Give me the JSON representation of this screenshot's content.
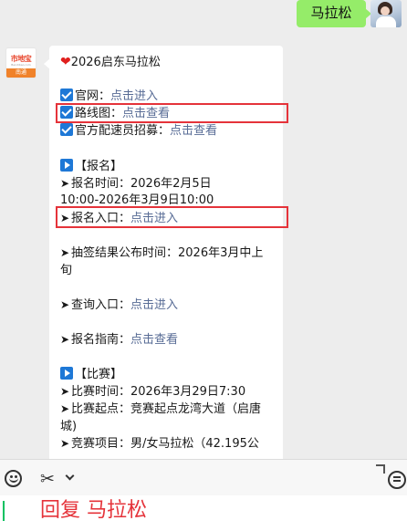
{
  "outgoing": {
    "text": "马拉松"
  },
  "bot": {
    "logo_main": "市地宝",
    "logo_sub": "Bendibao.com",
    "logo_city": "南通"
  },
  "message": {
    "title": "2026启东马拉松",
    "official_site_label": "官网：",
    "official_site_link": "点击进入",
    "route_label": "路线图：",
    "route_link": "点击查看",
    "pacer_label": "官方配速员招募：",
    "pacer_link": "点击查看",
    "reg_section": "【报名】",
    "reg_time_l1": "报名时间：2026年2月5日",
    "reg_time_l2": "10:00-2026年3月9日10:00",
    "reg_entry_label": "报名入口：",
    "reg_entry_link": "点击进入",
    "lottery": "抽签结果公布时间：2026年3月中上旬",
    "query_label": "查询入口：",
    "query_link": "点击进入",
    "guide_label": "报名指南：",
    "guide_link": "点击查看",
    "race_section": "【比赛】",
    "race_time": "比赛时间：2026年3月29日7:30",
    "race_start": "比赛起点：竞赛起点龙湾大道（启唐城)",
    "race_item": "竞赛项目：男/女马拉松（42.195公"
  },
  "composer": {
    "text": "回复 马拉松"
  },
  "colors": {
    "highlight_box": "#e5333a",
    "link": "#576b95",
    "user_bubble": "#95ec69"
  },
  "icons": [
    "emoji-icon",
    "scissors-icon",
    "chevron-down-icon",
    "corner-icon",
    "history-icon"
  ]
}
